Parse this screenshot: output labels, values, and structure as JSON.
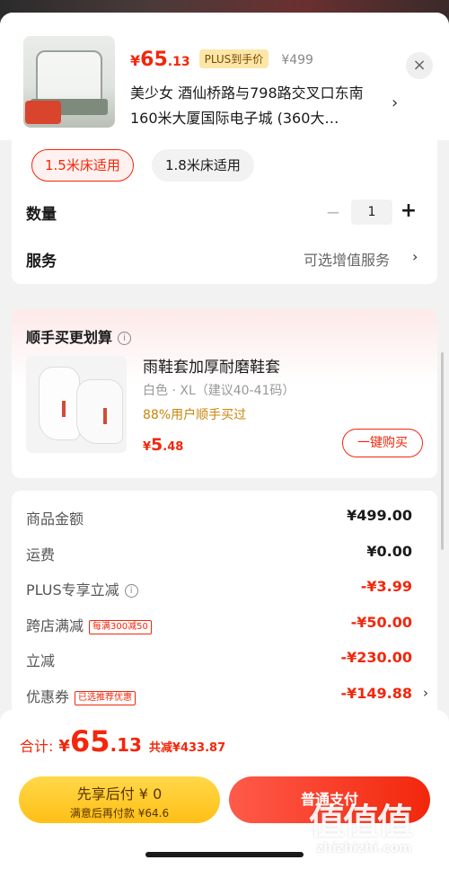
{
  "product": {
    "price_currency": "¥",
    "price_int": "65",
    "price_dec": ".13",
    "plus_badge": "PLUS到手价",
    "original_price": "¥499",
    "address": "美少女  酒仙桥路与798路交叉口东南160米大厦国际电子城 (360大…",
    "close_icon": "×",
    "chevron": "›"
  },
  "options": {
    "size_options": [
      "1.5米床适用",
      "1.8米床适用"
    ],
    "selected_size": "1.5米床适用",
    "quantity_label": "数量",
    "quantity_value": "1",
    "minus": "−",
    "plus": "+",
    "service_label": "服务",
    "service_value": "可选增值服务",
    "chevron": "›"
  },
  "addon": {
    "title": "顺手买更划算",
    "info_icon": "i",
    "name": "雨鞋套加厚耐磨鞋套",
    "spec": "白色 · XL（建议40-41码）",
    "percent_text": "88%用户顺手买过",
    "price_currency": "¥",
    "price_int": "5",
    "price_dec": ".48",
    "buy_button": "一键购买"
  },
  "summary": {
    "rows": [
      {
        "label": "商品金额",
        "value": "¥499.00"
      },
      {
        "label": "运费",
        "value": "¥0.00"
      },
      {
        "label": "PLUS专享立减",
        "value": "-¥3.99"
      },
      {
        "label": "跨店满减",
        "tag": "每满300减50",
        "value": "-¥50.00"
      },
      {
        "label": "立减",
        "value": "-¥230.00"
      },
      {
        "label": "优惠券",
        "tag": "已选推荐优惠",
        "value": "-¥149.88"
      }
    ],
    "info_icon": "i",
    "chevron": "›"
  },
  "bottom": {
    "total_label": "合计:",
    "total_currency": "¥",
    "total_int": "65",
    "total_dec": ".13",
    "total_saved": "共减¥433.87",
    "later_line1": "先享后付 ¥ 0",
    "later_line2": "满意后再付款 ¥64.6",
    "pay_button": "普通支付",
    "watermark": "值值值",
    "watermark_sub": "zhizhizhi.com"
  },
  "colors": {
    "accent_red": "#f2270c",
    "plus_gold": "#fce7a8",
    "later_yellow": "#ffc61e"
  }
}
